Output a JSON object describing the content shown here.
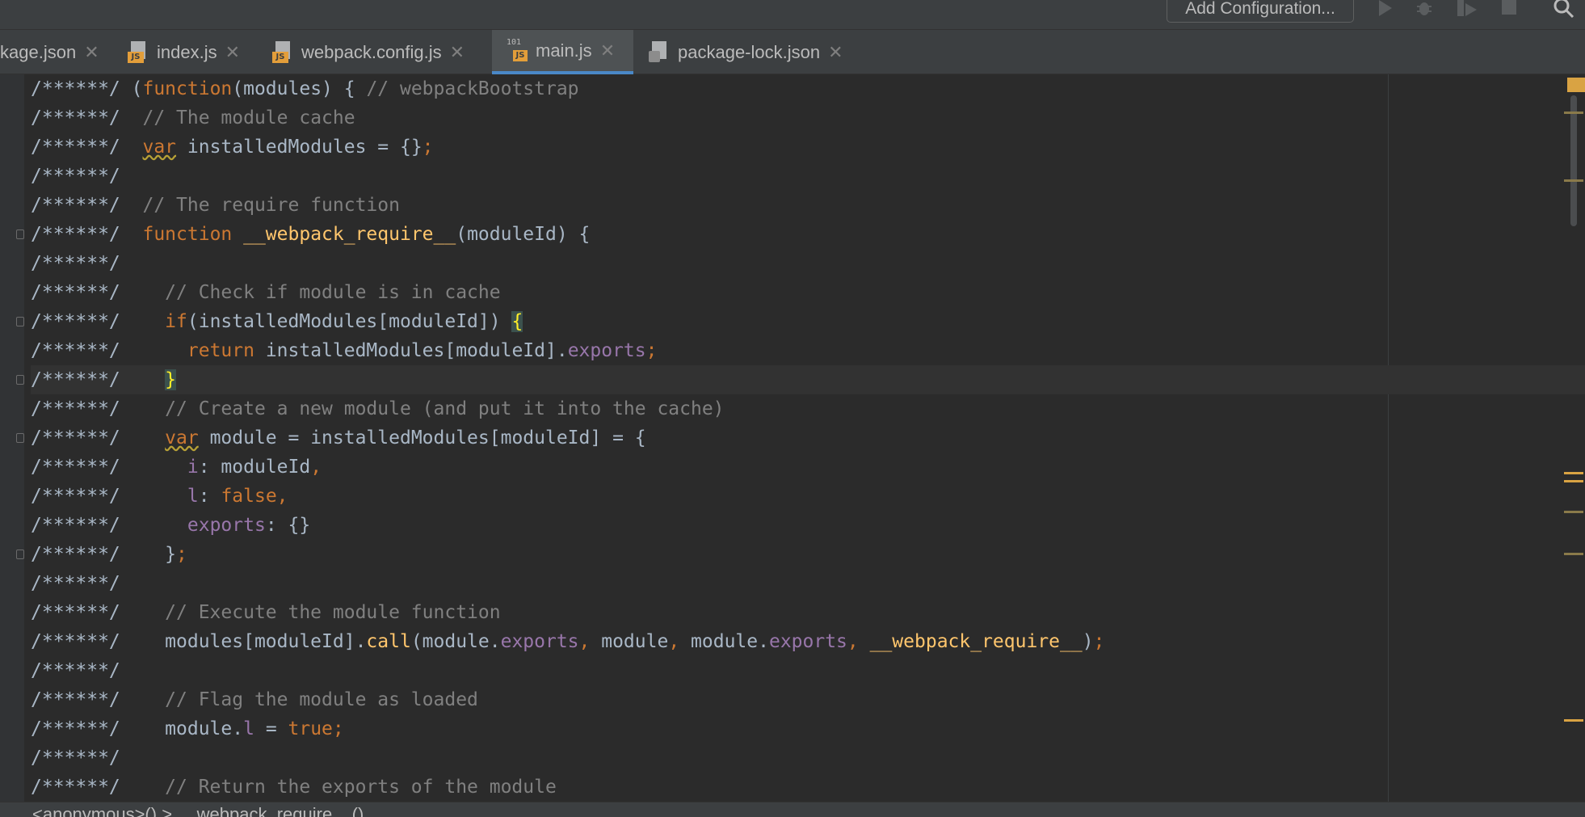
{
  "toolbar": {
    "config_label": "Add Configuration...",
    "icons": [
      "run-icon",
      "debug-icon",
      "coverage-icon",
      "stop-icon",
      "search-icon"
    ]
  },
  "tabs": [
    {
      "label": "kage.json",
      "icon": "json-file-icon",
      "active": false
    },
    {
      "label": "index.js",
      "icon": "js-file-icon",
      "active": false
    },
    {
      "label": "webpack.config.js",
      "icon": "js-file-icon",
      "active": false
    },
    {
      "label": "main.js",
      "icon": "binary-js-file-icon",
      "active": true
    },
    {
      "label": "package-lock.json",
      "icon": "lock-json-file-icon",
      "active": false
    }
  ],
  "code_lines": [
    [
      {
        "t": "/******/ ",
        "c": ""
      },
      {
        "t": "(",
        "c": ""
      },
      {
        "t": "function",
        "c": "kw"
      },
      {
        "t": "(modules) { ",
        "c": ""
      },
      {
        "t": "// webpackBootstrap",
        "c": "cm"
      }
    ],
    [
      {
        "t": "/******/  ",
        "c": ""
      },
      {
        "t": "// The module cache",
        "c": "cm"
      }
    ],
    [
      {
        "t": "/******/  ",
        "c": ""
      },
      {
        "t": "var",
        "c": "kw wv"
      },
      {
        "t": " installedModules = {}",
        "c": ""
      },
      {
        "t": ";",
        "c": "kw"
      }
    ],
    [
      {
        "t": "/******/",
        "c": ""
      }
    ],
    [
      {
        "t": "/******/  ",
        "c": ""
      },
      {
        "t": "// The require function",
        "c": "cm"
      }
    ],
    [
      {
        "t": "/******/  ",
        "c": ""
      },
      {
        "t": "function ",
        "c": "kw"
      },
      {
        "t": "__webpack_require__",
        "c": "fn"
      },
      {
        "t": "(moduleId) {",
        "c": ""
      }
    ],
    [
      {
        "t": "/******/",
        "c": ""
      }
    ],
    [
      {
        "t": "/******/    ",
        "c": ""
      },
      {
        "t": "// Check if module is in cache",
        "c": "cm"
      }
    ],
    [
      {
        "t": "/******/    ",
        "c": ""
      },
      {
        "t": "if",
        "c": "kw"
      },
      {
        "t": "(installedModules[moduleId]) ",
        "c": ""
      },
      {
        "t": "{",
        "c": "hl"
      }
    ],
    [
      {
        "t": "/******/      ",
        "c": ""
      },
      {
        "t": "return ",
        "c": "kw"
      },
      {
        "t": "installedModules[moduleId].",
        "c": ""
      },
      {
        "t": "exports",
        "c": "pr"
      },
      {
        "t": ";",
        "c": "kw"
      }
    ],
    [
      {
        "t": "/******/    ",
        "c": ""
      },
      {
        "t": "}",
        "c": "hl"
      }
    ],
    [
      {
        "t": "/******/    ",
        "c": ""
      },
      {
        "t": "// Create a new module (and put it into the cache)",
        "c": "cm"
      }
    ],
    [
      {
        "t": "/******/    ",
        "c": ""
      },
      {
        "t": "var",
        "c": "kw wv"
      },
      {
        "t": " module = installedModules[moduleId] = {",
        "c": ""
      }
    ],
    [
      {
        "t": "/******/      ",
        "c": ""
      },
      {
        "t": "i",
        "c": "pr"
      },
      {
        "t": ": moduleId",
        "c": ""
      },
      {
        "t": ",",
        "c": "kw"
      }
    ],
    [
      {
        "t": "/******/      ",
        "c": ""
      },
      {
        "t": "l",
        "c": "pr"
      },
      {
        "t": ": ",
        "c": ""
      },
      {
        "t": "false,",
        "c": "kw"
      }
    ],
    [
      {
        "t": "/******/      ",
        "c": ""
      },
      {
        "t": "exports",
        "c": "pr"
      },
      {
        "t": ": {}",
        "c": ""
      }
    ],
    [
      {
        "t": "/******/    ",
        "c": ""
      },
      {
        "t": "}",
        "c": ""
      },
      {
        "t": ";",
        "c": "kw"
      }
    ],
    [
      {
        "t": "/******/",
        "c": ""
      }
    ],
    [
      {
        "t": "/******/    ",
        "c": ""
      },
      {
        "t": "// Execute the module function",
        "c": "cm"
      }
    ],
    [
      {
        "t": "/******/    ",
        "c": ""
      },
      {
        "t": "modules[moduleId].",
        "c": ""
      },
      {
        "t": "call",
        "c": "fn"
      },
      {
        "t": "(module.",
        "c": ""
      },
      {
        "t": "exports",
        "c": "pr"
      },
      {
        "t": ", ",
        "c": "kw"
      },
      {
        "t": "module",
        "c": ""
      },
      {
        "t": ", ",
        "c": "kw"
      },
      {
        "t": "module.",
        "c": ""
      },
      {
        "t": "exports",
        "c": "pr"
      },
      {
        "t": ", ",
        "c": "kw"
      },
      {
        "t": "__webpack_require__",
        "c": "fn"
      },
      {
        "t": ")",
        "c": ""
      },
      {
        "t": ";",
        "c": "kw"
      }
    ],
    [
      {
        "t": "/******/",
        "c": ""
      }
    ],
    [
      {
        "t": "/******/    ",
        "c": ""
      },
      {
        "t": "// Flag the module as loaded",
        "c": "cm"
      }
    ],
    [
      {
        "t": "/******/    ",
        "c": ""
      },
      {
        "t": "module.",
        "c": ""
      },
      {
        "t": "l",
        "c": "pr"
      },
      {
        "t": " = ",
        "c": ""
      },
      {
        "t": "true;",
        "c": "kw"
      }
    ],
    [
      {
        "t": "/******/",
        "c": ""
      }
    ],
    [
      {
        "t": "/******/    ",
        "c": ""
      },
      {
        "t": "// Return the exports of the module",
        "c": "cm"
      }
    ]
  ],
  "caret_line": 10,
  "fold_lines": [
    5,
    8,
    10,
    12,
    16
  ],
  "statusbar": {
    "breadcrumb": "<anonymous>()  >  __webpack_require__()"
  },
  "colors": {
    "background": "#2b2b2b",
    "keyword": "#cc7832",
    "function": "#ffc66d",
    "property": "#9876aa",
    "comment": "#808080",
    "text": "#a9b7c6",
    "active_tab_underline": "#4a88c7"
  }
}
